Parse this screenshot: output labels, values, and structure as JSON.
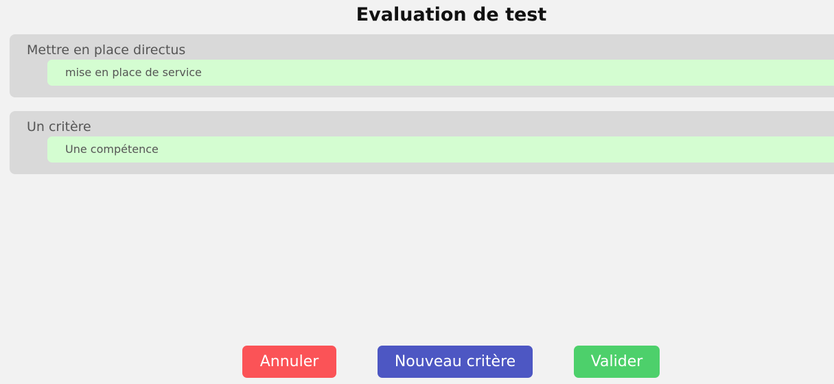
{
  "page": {
    "title": "Evaluation de test"
  },
  "criteria": [
    {
      "title": "Mettre en place directus",
      "skill": "mise en place de service"
    },
    {
      "title": "Un critère",
      "skill": "Une compétence"
    }
  ],
  "actions": {
    "cancel_label": "Annuler",
    "new_criterion_label": "Nouveau critère",
    "validate_label": "Valider"
  },
  "colors": {
    "background": "#f2f2f2",
    "card": "#d9d9d9",
    "skill": "#d4fdd1",
    "cancel": "#fb5357",
    "new_criterion": "#4d57c3",
    "validate": "#4dd06b"
  }
}
